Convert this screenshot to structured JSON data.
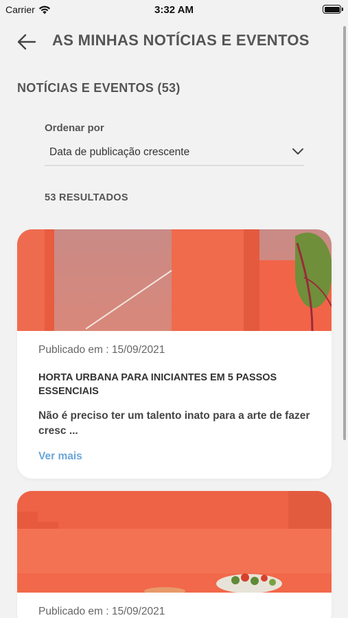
{
  "status_bar": {
    "carrier": "Carrier",
    "time": "3:32 AM",
    "wifi_icon": "wifi-icon",
    "battery_icon": "battery-icon"
  },
  "header": {
    "back_icon": "arrow-left-icon",
    "title": "AS MINHAS NOTÍCIAS E EVENTOS"
  },
  "section": {
    "title": "NOTÍCIAS E EVENTOS (53)"
  },
  "sort": {
    "label": "Ordenar por",
    "value": "Data de publicação crescente",
    "icon": "chevron-down-icon"
  },
  "results": {
    "count_label": "53 RESULTADOS"
  },
  "cards": [
    {
      "date": "Publicado em : 15/09/2021",
      "title": "HORTA URBANA PARA INICIANTES EM 5 PASSOS ESSENCIAIS",
      "excerpt": "Não é preciso ter um talento inato para a arte de fazer cresc ...",
      "more": "Ver mais"
    },
    {
      "date": "Publicado em : 15/09/2021"
    }
  ],
  "colors": {
    "background": "#f2f2f2",
    "accent_orange": "#f0603e",
    "link_blue": "#6aa6d8"
  }
}
